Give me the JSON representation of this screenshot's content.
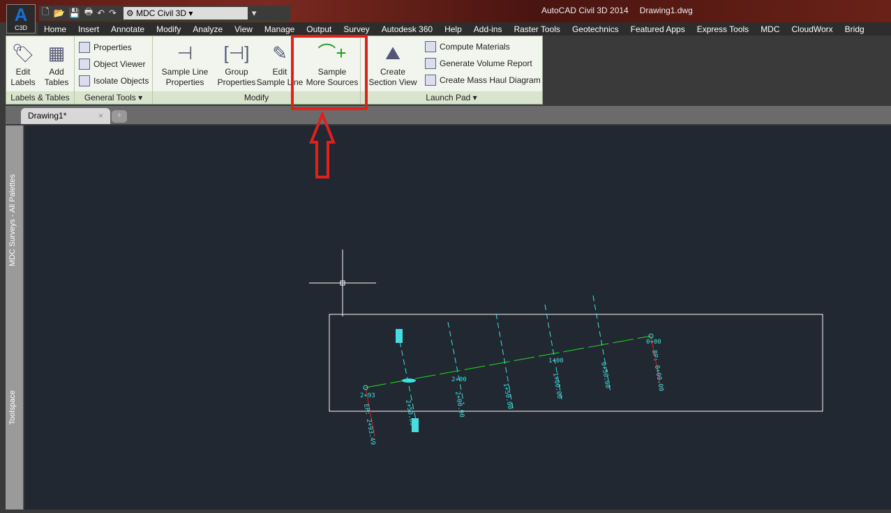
{
  "app": {
    "badge": "C3D",
    "workspace": "MDC Civil 3D",
    "title": "AutoCAD Civil 3D 2014",
    "file": "Drawing1.dwg"
  },
  "menu_tabs": [
    "Home",
    "Insert",
    "Annotate",
    "Modify",
    "Analyze",
    "View",
    "Manage",
    "Output",
    "Survey",
    "Autodesk 360",
    "Help",
    "Add-ins",
    "Raster Tools",
    "Geotechnics",
    "Featured Apps",
    "Express Tools",
    "MDC",
    "CloudWorx",
    "Bridg"
  ],
  "ribbon": {
    "labels_tables": {
      "title": "Labels & Tables",
      "edit": "Edit\nLabels",
      "add": "Add\nTables"
    },
    "general": {
      "title": "General Tools",
      "items": [
        "Properties",
        "Object Viewer",
        "Isolate Objects"
      ]
    },
    "modify": {
      "title": "Modify",
      "slp": "Sample Line\nProperties",
      "gp": "Group\nProperties",
      "esl": "Edit\nSample Line",
      "sms": "Sample\nMore Sources"
    },
    "launch": {
      "title": "Launch Pad",
      "csv": "Create\nSection View",
      "items": [
        "Compute Materials",
        "Generate Volume Report",
        "Create Mass Haul Diagram"
      ]
    }
  },
  "doc_tab": {
    "name": "Drawing1*",
    "close": "×"
  },
  "palettes": {
    "top": "MDC Surveys - All Palettes",
    "bottom": "Toolspace"
  },
  "drawing": {
    "labels": [
      "2+93",
      "EP: 2+93.49",
      "2+50.00",
      "2+00",
      "2+00.00",
      "1+50.00",
      "1+00",
      "1+00.00",
      "0+50.00",
      "0+00",
      "BP: 0+00.00"
    ]
  },
  "colors": {
    "highlight": "#e02020",
    "alignment": "#20e020",
    "sample_lines": "#40e0e0"
  }
}
